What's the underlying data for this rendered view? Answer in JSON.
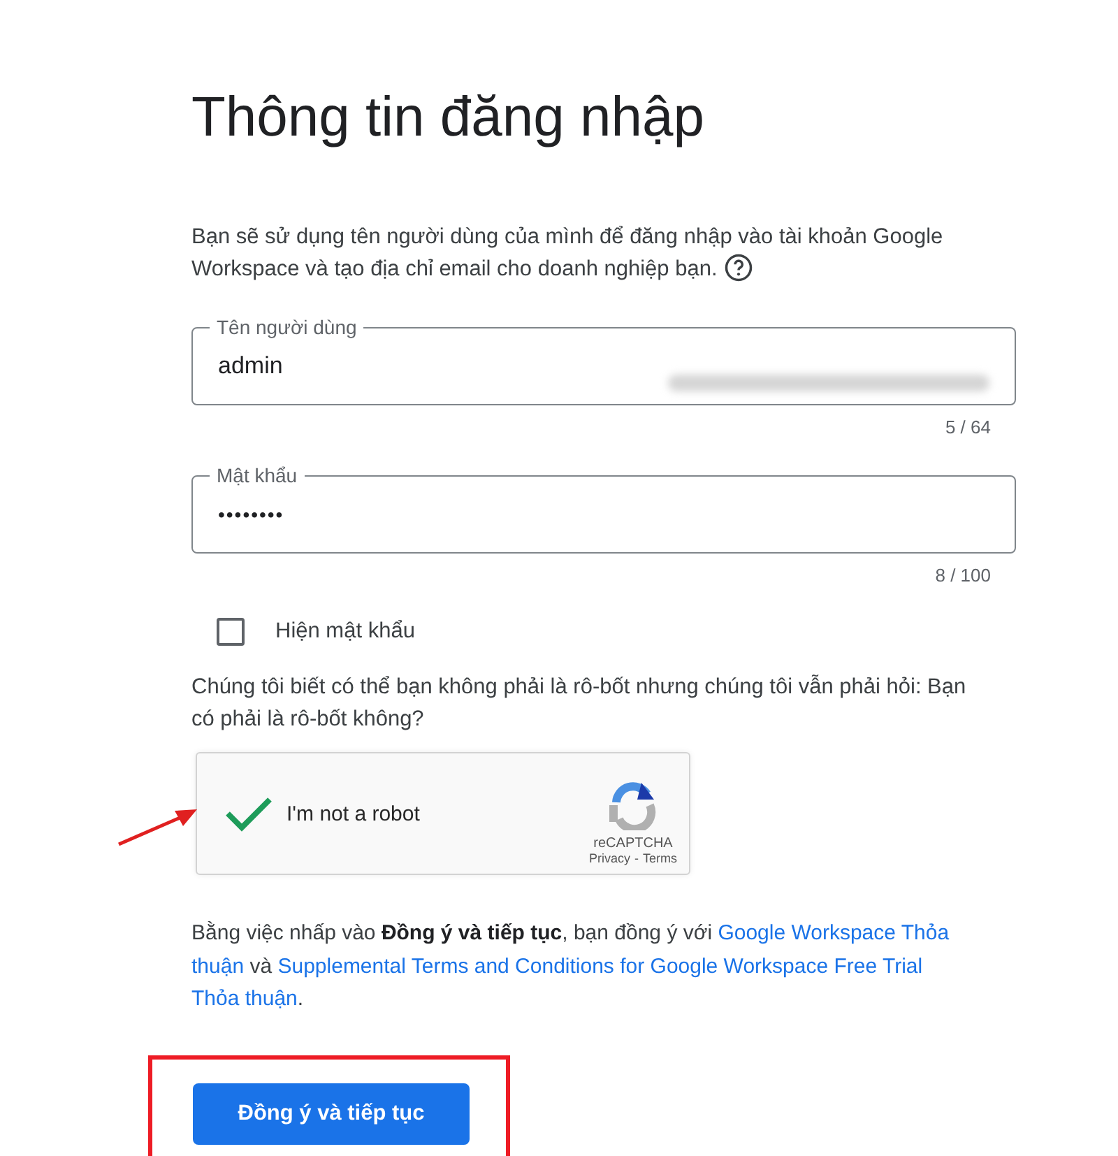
{
  "title": "Thông tin đăng nhập",
  "description": "Bạn sẽ sử dụng tên người dùng của mình để đăng nhập vào tài khoản Google Workspace và tạo địa chỉ email cho doanh nghiệp bạn.",
  "fields": [
    {
      "label": "Tên người dùng",
      "value": "admin",
      "counter": "5 / 64",
      "blurred_suffix": true
    },
    {
      "label": "Mật khẩu",
      "value": "••••••••",
      "counter": "8 / 100",
      "blurred_suffix": false
    }
  ],
  "show_password": {
    "label": "Hiện mật khẩu",
    "checked": false
  },
  "robot_question": "Chúng tôi biết có thể bạn không phải là rô-bốt nhưng chúng tôi vẫn phải hỏi: Bạn có phải là rô-bốt không?",
  "captcha": {
    "label": "I'm not a robot",
    "checked": true,
    "brand": "reCAPTCHA",
    "privacy": "Privacy",
    "separator": "-",
    "terms": "Terms"
  },
  "agreement": [
    {
      "kind": "text",
      "text": "Bằng việc nhấp vào "
    },
    {
      "kind": "bold",
      "text": "Đồng ý và tiếp tục"
    },
    {
      "kind": "text",
      "text": ", bạn đồng ý với "
    },
    {
      "kind": "link",
      "text": "Google Workspace Thỏa thuận"
    },
    {
      "kind": "text",
      "text": " và "
    },
    {
      "kind": "link",
      "text": "Supplemental Terms and Conditions for Google Workspace Free Trial Thỏa thuận"
    },
    {
      "kind": "text",
      "text": "."
    }
  ],
  "submit_button": "Đồng ý và tiếp tục",
  "annotations": {
    "arrow": true,
    "highlight_box": true
  }
}
